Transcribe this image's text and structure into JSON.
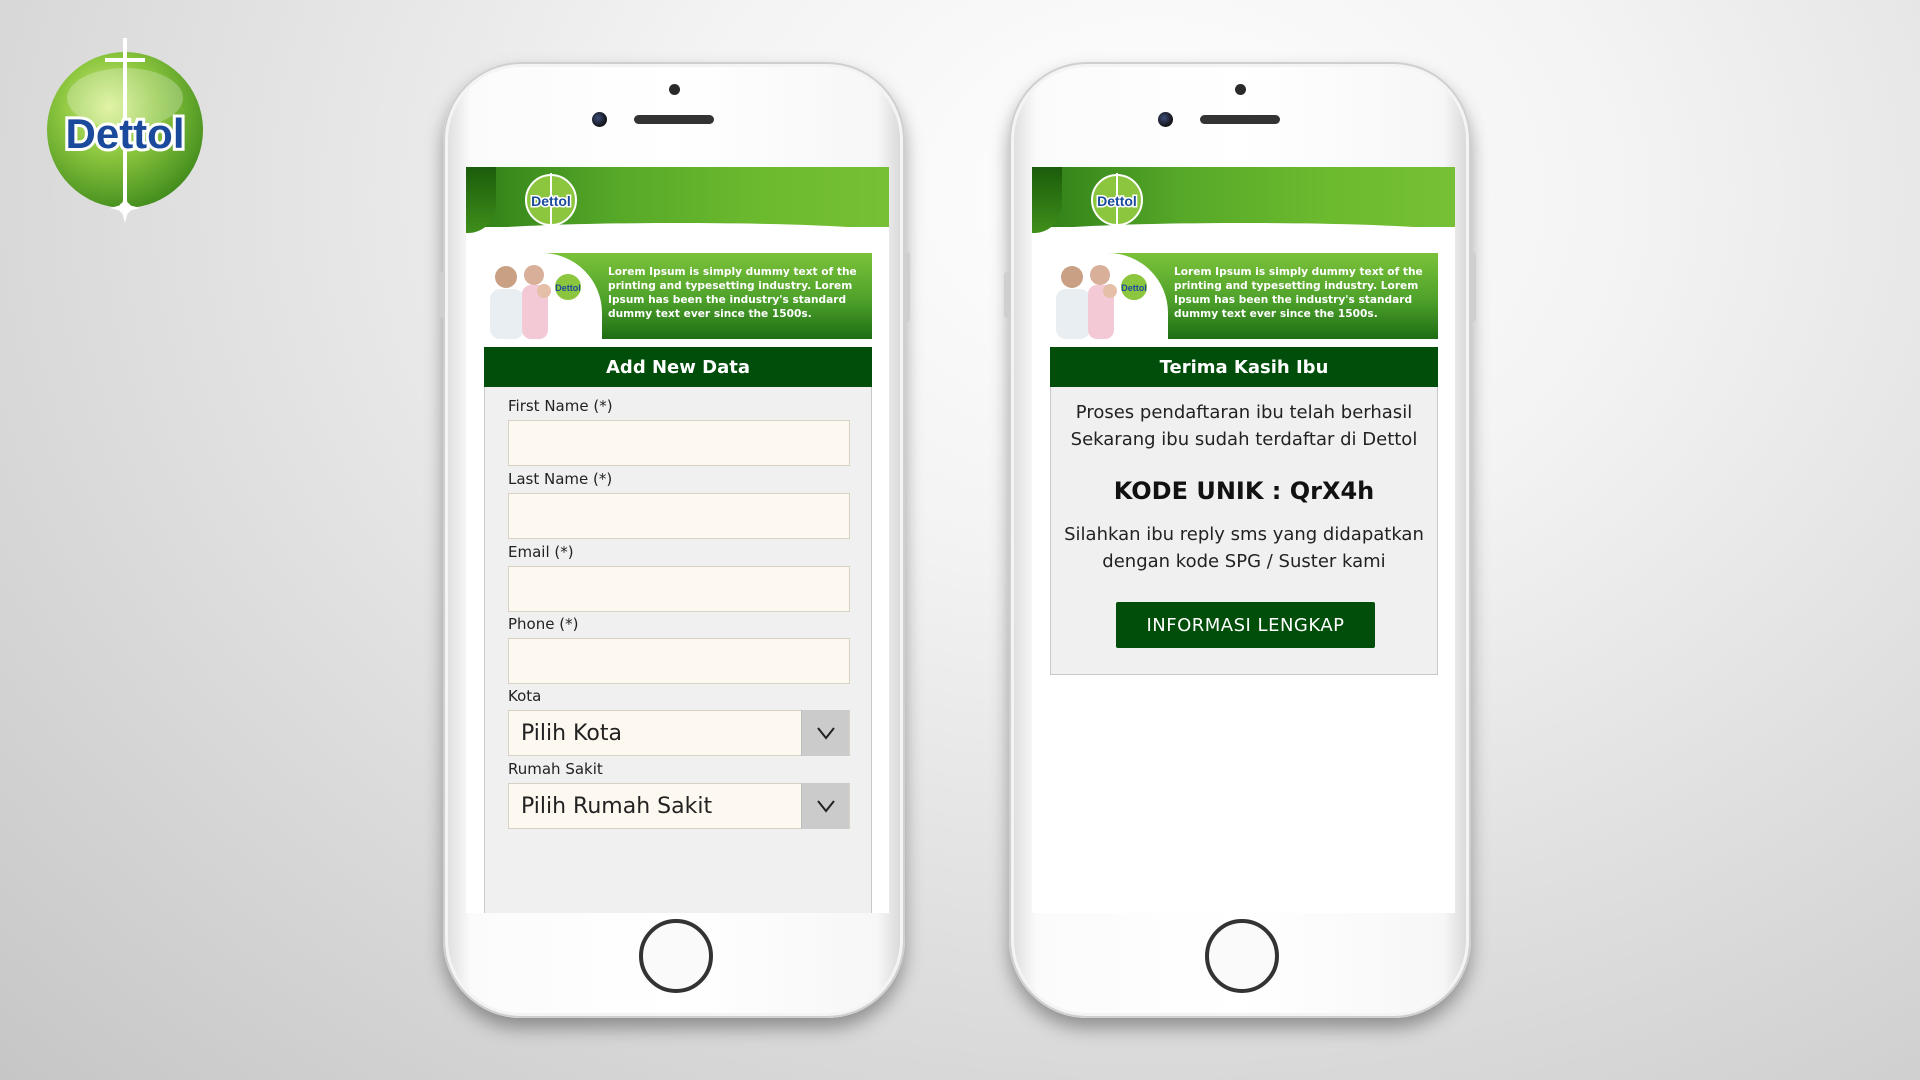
{
  "brand": {
    "logo_text": "Dettol",
    "colors": {
      "dark_green": "#004e0a",
      "light_green": "#6cba2e",
      "field_bg": "#fdf9f0"
    }
  },
  "banner": {
    "text": "Lorem Ipsum is simply dummy text of the printing and typesetting industry. Lorem Ipsum has been the industry's standard dummy text ever since the 1500s."
  },
  "form": {
    "title": "Add New Data",
    "fields": [
      {
        "label": "First Name (*)",
        "value": ""
      },
      {
        "label": "Last Name (*)",
        "value": ""
      },
      {
        "label": "Email (*)",
        "value": ""
      },
      {
        "label": "Phone (*)",
        "value": ""
      }
    ],
    "selects": [
      {
        "label": "Kota",
        "value": "Pilih Kota",
        "icon": "chevron-down-icon"
      },
      {
        "label": "Rumah Sakit",
        "value": "Pilih Rumah Sakit",
        "icon": "chevron-down-icon"
      }
    ]
  },
  "confirmation": {
    "title": "Terima Kasih Ibu",
    "line1": "Proses pendaftaran ibu telah berhasil",
    "line2": "Sekarang ibu sudah terdaftar di Dettol",
    "code_line": "KODE UNIK  :  QrX4h",
    "line3": "Silahkan ibu reply sms yang didapatkan",
    "line4": "dengan kode SPG / Suster kami",
    "button_label": "INFORMASI LENGKAP"
  }
}
